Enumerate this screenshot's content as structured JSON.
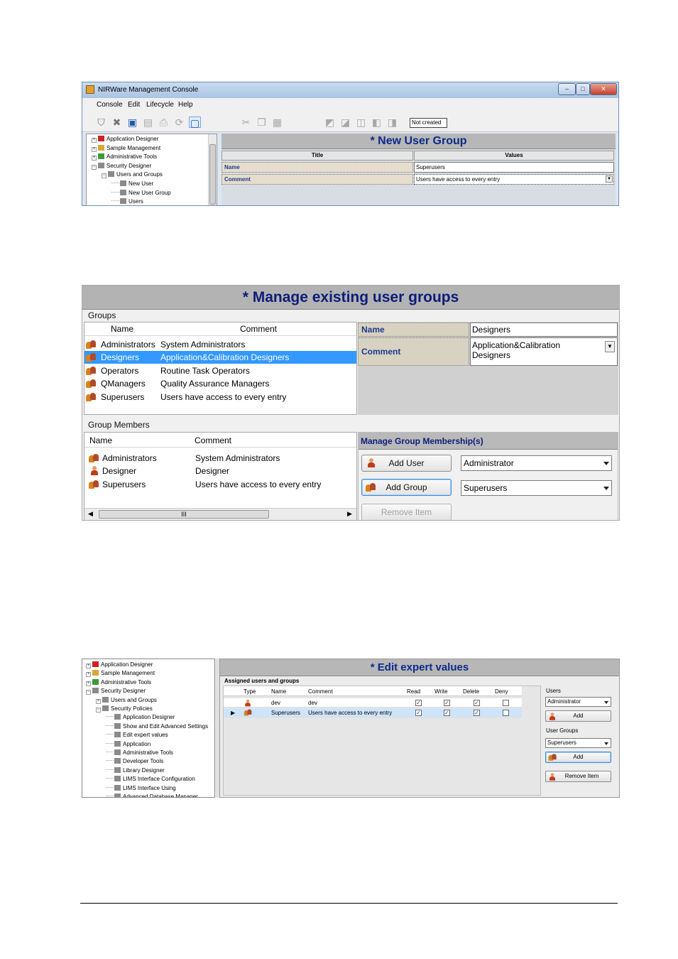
{
  "shot1": {
    "window_title": "NIRWare Management Console",
    "window_buttons": {
      "minimize": "–",
      "maximize": "□",
      "close": "✕"
    },
    "menu": [
      "Console",
      "Edit",
      "Lifecycle",
      "Help"
    ],
    "status_box": "Not created",
    "tree": [
      {
        "label": "Application Designer",
        "color": "#cc2222",
        "level": 0,
        "toggle": "+"
      },
      {
        "label": "Sample Management",
        "color": "#d8a830",
        "level": 0,
        "toggle": "+"
      },
      {
        "label": "Administrative Tools",
        "color": "#3a9a3a",
        "level": 0,
        "toggle": "+"
      },
      {
        "label": "Security Designer",
        "color": "#8a8a8a",
        "level": 0,
        "toggle": "−"
      },
      {
        "label": "Users and Groups",
        "color": "#8a8a8a",
        "level": 1,
        "toggle": "−"
      },
      {
        "label": "New User",
        "color": "#8a8a8a",
        "level": 2,
        "toggle": ""
      },
      {
        "label": "New User Group",
        "color": "#8a8a8a",
        "level": 2,
        "toggle": ""
      },
      {
        "label": "Users",
        "color": "#8a8a8a",
        "level": 2,
        "toggle": ""
      }
    ],
    "panel_title": "* New User Group",
    "col_title": "Title",
    "col_values": "Values",
    "fields": [
      {
        "name": "Name",
        "value": "Superusers"
      },
      {
        "name": "Comment",
        "value": "Users have access to every entry"
      }
    ]
  },
  "shot2": {
    "title": "* Manage existing user groups",
    "groups_label": "Groups",
    "groups_columns": {
      "name": "Name",
      "comment": "Comment"
    },
    "groups": [
      {
        "name": "Administrators",
        "comment": "System Administrators",
        "selected": false
      },
      {
        "name": "Designers",
        "comment": "Application&Calibration Designers",
        "selected": true
      },
      {
        "name": "Operators",
        "comment": "Routine Task Operators",
        "selected": false
      },
      {
        "name": "QManagers",
        "comment": "Quality Assurance Managers",
        "selected": false
      },
      {
        "name": "Superusers",
        "comment": "Users have access to every entry",
        "selected": false
      }
    ],
    "prop_name_label": "Name",
    "prop_name_value": "Designers",
    "prop_comment_label": "Comment",
    "prop_comment_value_line1": "Application&Calibration",
    "prop_comment_value_line2": "Designers",
    "members_label": "Group Members",
    "members_columns": {
      "name": "Name",
      "comment": "Comment"
    },
    "members": [
      {
        "name": "Administrators",
        "comment": "System Administrators",
        "type": "group"
      },
      {
        "name": "Designer",
        "comment": "Designer",
        "type": "user"
      },
      {
        "name": "Superusers",
        "comment": "Users have access to every entry",
        "type": "group"
      }
    ],
    "scroll_thumb_glyph": "III",
    "manage_title": "Manage Group Membership(s)",
    "add_user_label": "Add User",
    "add_user_combo": "Administrator",
    "add_group_label": "Add Group",
    "add_group_combo": "Superusers",
    "remove_label": "Remove Item"
  },
  "shot3": {
    "tree": [
      {
        "label": "Application Designer",
        "color": "#cc2222",
        "level": 0,
        "toggle": "+"
      },
      {
        "label": "Sample Management",
        "color": "#d8a830",
        "level": 0,
        "toggle": "+"
      },
      {
        "label": "Administrative Tools",
        "color": "#3a9a3a",
        "level": 0,
        "toggle": "+"
      },
      {
        "label": "Security Designer",
        "color": "#8a8a8a",
        "level": 0,
        "toggle": "−"
      },
      {
        "label": "Users and Groups",
        "color": "#8a8a8a",
        "level": 1,
        "toggle": "+"
      },
      {
        "label": "Security Policies",
        "color": "#8a8a8a",
        "level": 1,
        "toggle": "−"
      },
      {
        "label": "Application Designer",
        "color": "#8a8a8a",
        "level": 2,
        "toggle": ""
      },
      {
        "label": "Show and Edit Advanced Settings",
        "color": "#8a8a8a",
        "level": 2,
        "toggle": ""
      },
      {
        "label": "Edit expert values",
        "color": "#8a8a8a",
        "level": 2,
        "toggle": ""
      },
      {
        "label": "Application",
        "color": "#8a8a8a",
        "level": 2,
        "toggle": ""
      },
      {
        "label": "Administrative Tools",
        "color": "#8a8a8a",
        "level": 2,
        "toggle": ""
      },
      {
        "label": "Developer Tools",
        "color": "#8a8a8a",
        "level": 2,
        "toggle": ""
      },
      {
        "label": "Library Designer",
        "color": "#8a8a8a",
        "level": 2,
        "toggle": ""
      },
      {
        "label": "LIMS Interface Configuration",
        "color": "#8a8a8a",
        "level": 2,
        "toggle": ""
      },
      {
        "label": "LIMS Interface Using",
        "color": "#8a8a8a",
        "level": 2,
        "toggle": ""
      },
      {
        "label": "Advanced Database Manager",
        "color": "#8a8a8a",
        "level": 2,
        "toggle": ""
      }
    ],
    "title": "* Edit expert values",
    "assigned_label": "Assigned users and groups",
    "columns": {
      "type": "Type",
      "name": "Name",
      "comment": "Comment",
      "read": "Read",
      "write": "Write",
      "delete": "Delete",
      "deny": "Deny"
    },
    "rows": [
      {
        "type": "user",
        "name": "dev",
        "comment": "dev",
        "read": true,
        "write": true,
        "delete": true,
        "deny": false
      },
      {
        "type": "group",
        "name": "Superusers",
        "comment": "Users have access to every entry",
        "read": true,
        "write": true,
        "delete": true,
        "deny": false
      }
    ],
    "row_pointer": "▶",
    "check_glyph": "✓",
    "users_label": "Users",
    "users_combo": "Administrator",
    "users_add": "Add",
    "groups_label": "User Groups",
    "groups_combo": "Superusers",
    "groups_add": "Add",
    "remove_label": "Remove Item"
  }
}
